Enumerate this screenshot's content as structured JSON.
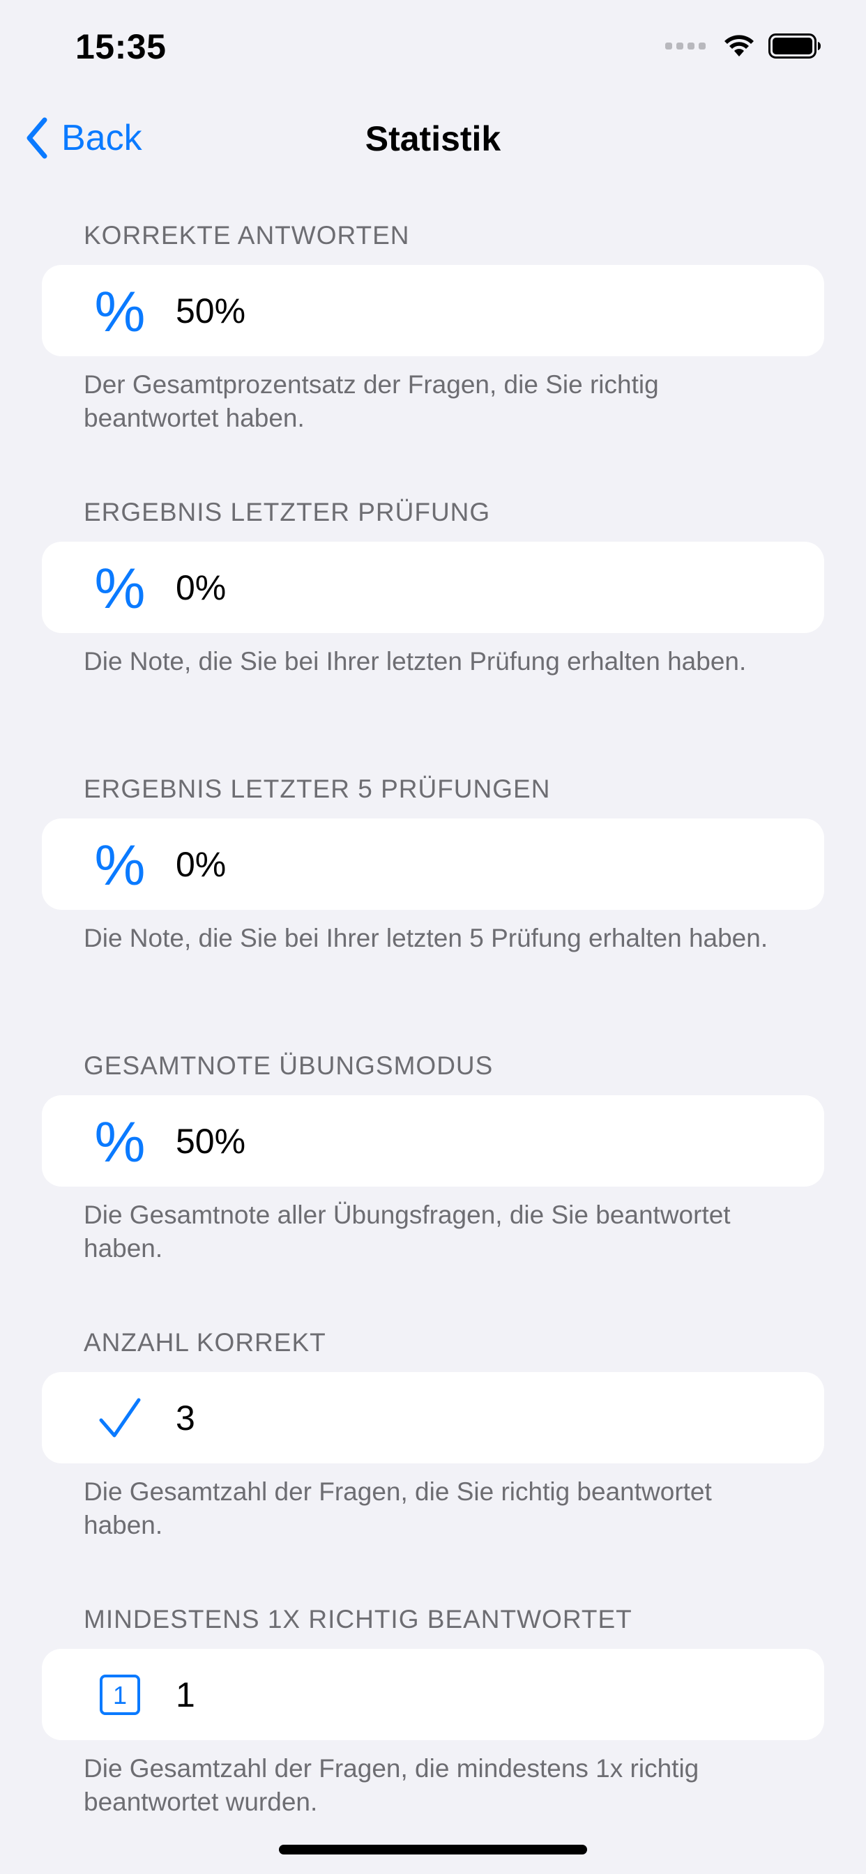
{
  "status_bar": {
    "time": "15:35",
    "icons": [
      "signal-dots-icon",
      "wifi-icon",
      "battery-icon"
    ]
  },
  "nav": {
    "back_label": "Back",
    "title": "Statistik"
  },
  "colors": {
    "accent": "#0A7AFF",
    "background": "#F2F2F7",
    "card": "#FFFFFF",
    "secondary_text": "#6D6D72"
  },
  "sections": [
    {
      "header": "KORREKTE ANTWORTEN",
      "icon": "percent-icon",
      "value": "50%",
      "footer": "Der Gesamtprozentsatz der Fragen, die Sie richtig beantwortet haben."
    },
    {
      "header": "ERGEBNIS LETZTER PRÜFUNG",
      "icon": "percent-icon",
      "value": "0%",
      "footer": "Die Note, die Sie bei Ihrer letzten Prüfung erhalten haben."
    },
    {
      "header": "ERGEBNIS LETZTER 5 PRÜFUNGEN",
      "icon": "percent-icon",
      "value": "0%",
      "footer": "Die Note, die Sie bei Ihrer letzten 5 Prüfung erhalten haben."
    },
    {
      "header": "GESAMTNOTE ÜBUNGSMODUS",
      "icon": "percent-icon",
      "value": "50%",
      "footer": "Die Gesamtnote aller Übungsfragen, die Sie beantwortet haben."
    },
    {
      "header": "ANZAHL KORREKT",
      "icon": "checkmark-icon",
      "value": "3",
      "footer": "Die Gesamtzahl der Fragen, die Sie richtig beantwortet haben."
    },
    {
      "header": "MINDESTENS 1X RICHTIG BEANTWORTET",
      "icon": "number-one-square-icon",
      "icon_text": "1",
      "value": "1",
      "footer": "Die Gesamtzahl der Fragen, die mindestens 1x richtig beantwortet wurden."
    }
  ]
}
